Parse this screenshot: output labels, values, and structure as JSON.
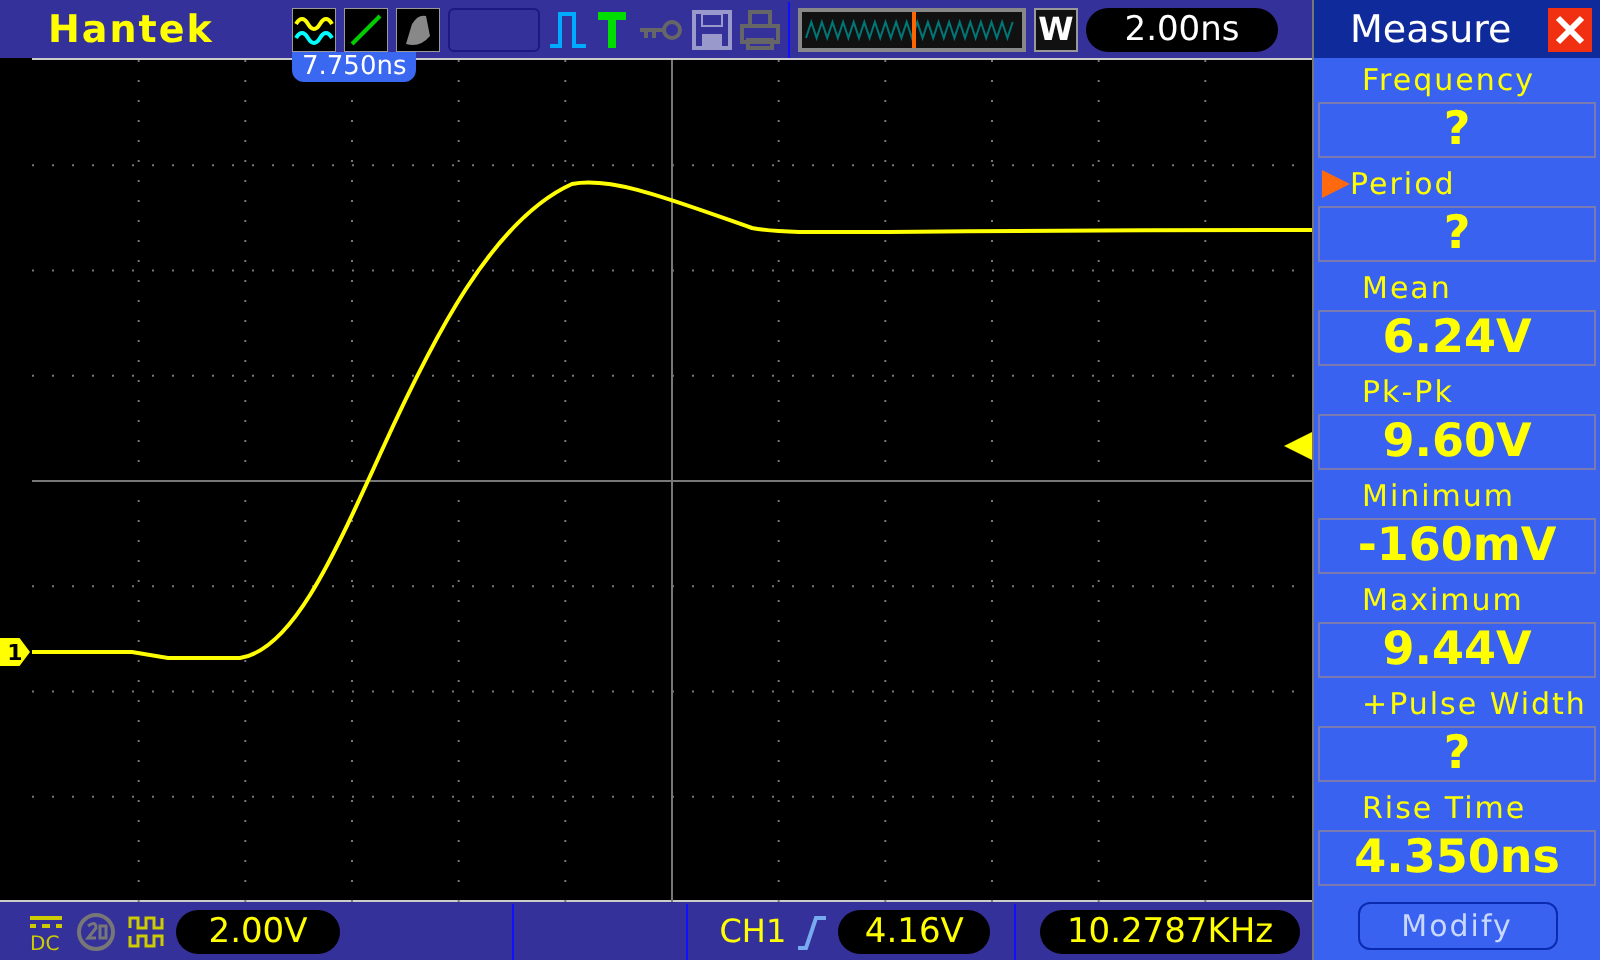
{
  "top_bar": {
    "logo": "Hantek",
    "zoom_key": "W",
    "timebase": "2.00ns"
  },
  "trigger_position": "7.750ns",
  "channel": {
    "marker": "1",
    "coupling": "DC",
    "scale": "2.00V"
  },
  "trigger": {
    "source": "CH1",
    "level": "4.16V"
  },
  "frequency_counter": "10.2787KHz",
  "measure_panel": {
    "title": "Measure",
    "modify": "Modify",
    "items": [
      {
        "label": "Frequency",
        "value": "?",
        "selected": false
      },
      {
        "label": "Period",
        "value": "?",
        "selected": true
      },
      {
        "label": "Mean",
        "value": "6.24V",
        "selected": false
      },
      {
        "label": "Pk-Pk",
        "value": "9.60V",
        "selected": false
      },
      {
        "label": "Minimum",
        "value": "-160mV",
        "selected": false
      },
      {
        "label": "Maximum",
        "value": "9.44V",
        "selected": false
      },
      {
        "label": "+Pulse Width",
        "value": "?",
        "selected": false
      },
      {
        "label": "Rise Time",
        "value": "4.350ns",
        "selected": false
      }
    ]
  }
}
